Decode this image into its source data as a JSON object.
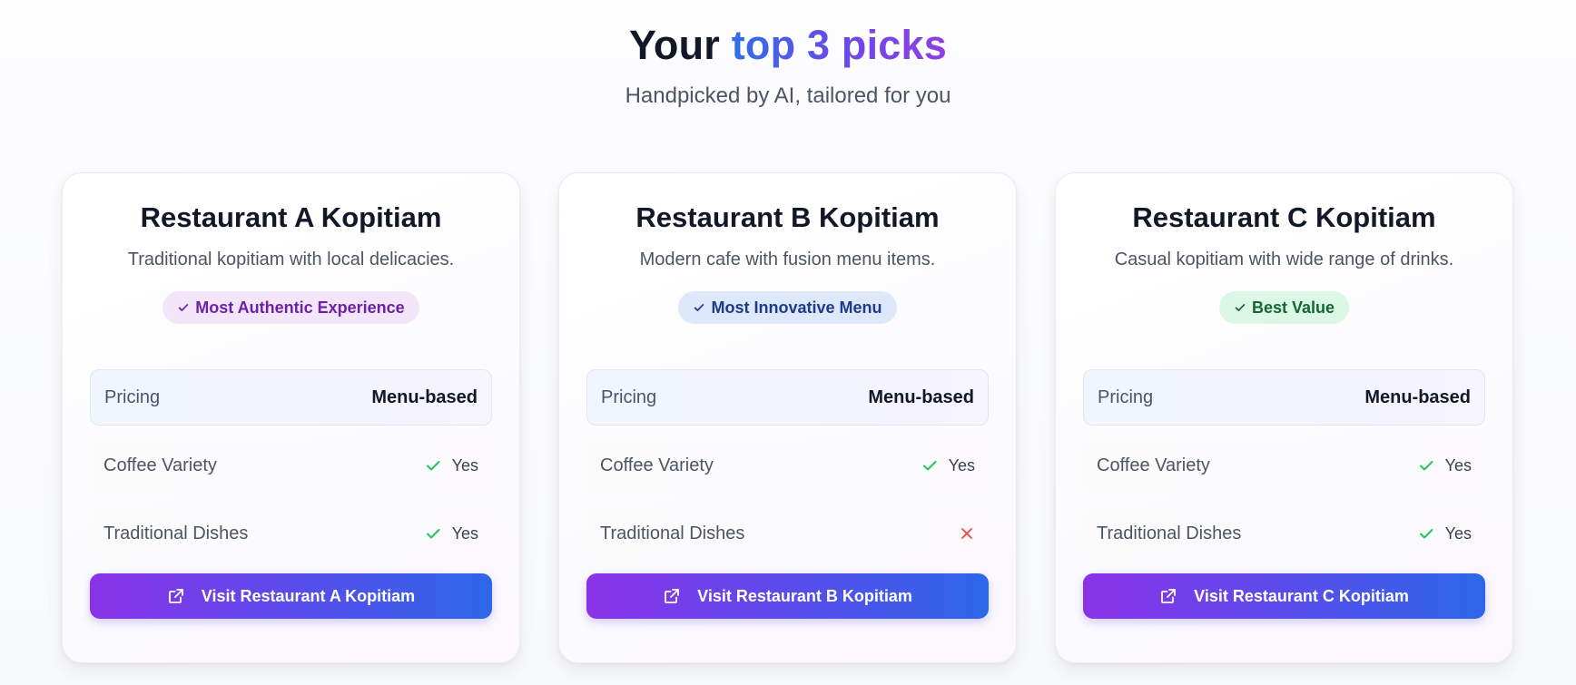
{
  "header": {
    "title_prefix": "Your",
    "title_highlight": "top 3 picks",
    "subtitle": "Handpicked by AI, tailored for you"
  },
  "cards": [
    {
      "name": "Restaurant A Kopitiam",
      "description": "Traditional kopitiam with local delicacies.",
      "badge": "Most Authentic Experience",
      "badge_color": "#6b21a8",
      "pricing_label": "Pricing",
      "pricing_value": "Menu-based",
      "coffee_label": "Coffee Variety",
      "coffee_value": "Yes",
      "dishes_label": "Traditional Dishes",
      "dishes_value": "Yes",
      "button_label": "Visit Restaurant A Kopitiam"
    },
    {
      "name": "Restaurant B Kopitiam",
      "description": "Modern cafe with fusion menu items.",
      "badge": "Most Innovative Menu",
      "badge_color": "#1e3a8a",
      "pricing_label": "Pricing",
      "pricing_value": "Menu-based",
      "coffee_label": "Coffee Variety",
      "coffee_value": "Yes",
      "dishes_label": "Traditional Dishes",
      "dishes_value": "",
      "button_label": "Visit Restaurant B Kopitiam"
    },
    {
      "name": "Restaurant C Kopitiam",
      "description": "Casual kopitiam with wide range of drinks.",
      "badge": "Best Value",
      "badge_color": "#166534",
      "pricing_label": "Pricing",
      "pricing_value": "Menu-based",
      "coffee_label": "Coffee Variety",
      "coffee_value": "Yes",
      "dishes_label": "Traditional Dishes",
      "dishes_value": "Yes",
      "button_label": "Visit Restaurant C Kopitiam"
    }
  ],
  "colors": {
    "check": "#22c55e",
    "cross": "#ef4444",
    "button_gradient_start": "#8b32e7",
    "button_gradient_end": "#2c67e8"
  },
  "icons": {
    "badge": "check-icon",
    "yes": "check-icon",
    "no": "x-icon",
    "button": "external-link-icon"
  }
}
